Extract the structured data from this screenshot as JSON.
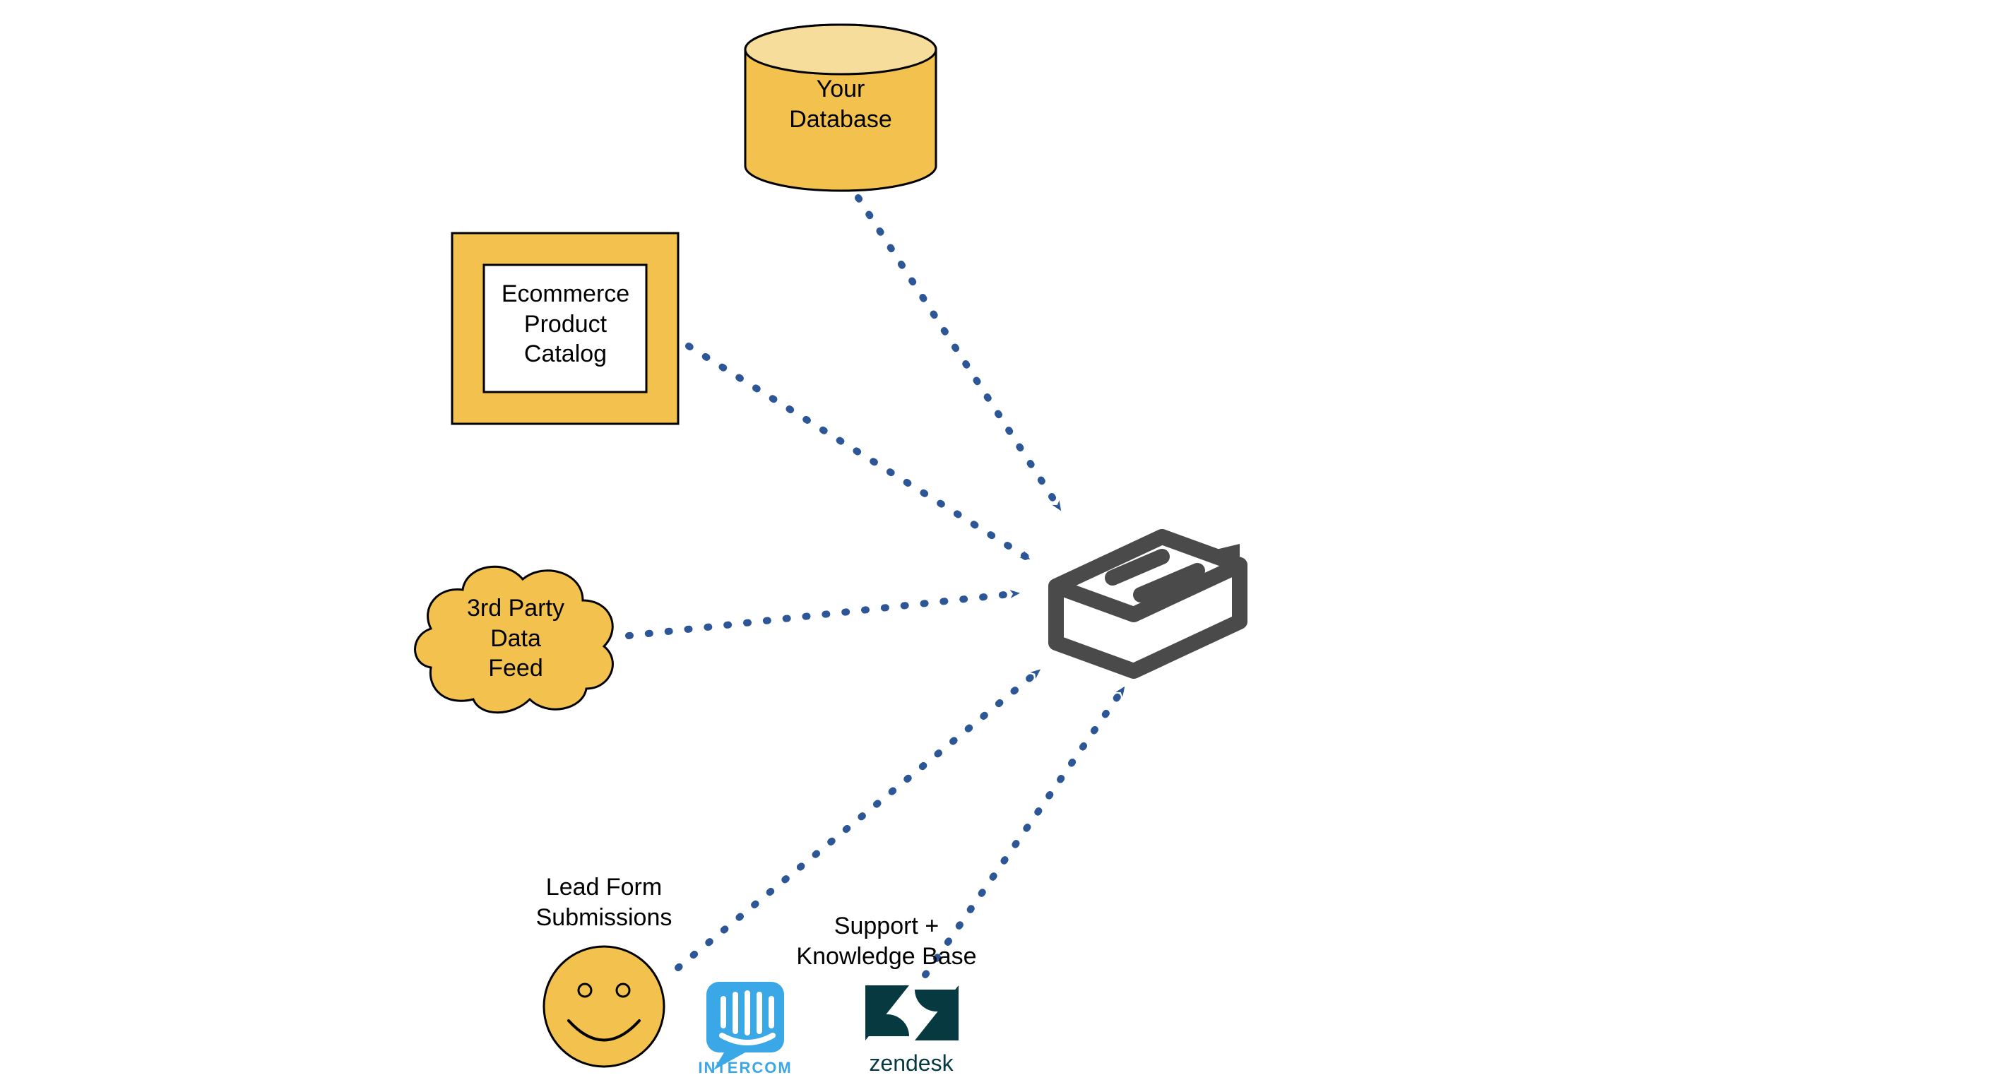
{
  "diagram": {
    "nodes": {
      "database": {
        "label": "Your\nDatabase"
      },
      "catalog": {
        "label": "Ecommerce\nProduct\nCatalog"
      },
      "feed": {
        "label": "3rd Party\nData\nFeed"
      },
      "leads": {
        "label": "Lead Form\nSubmissions"
      },
      "support": {
        "label": "Support +\nKnowledge Base"
      },
      "intercom": {
        "label": "INTERCOM"
      },
      "zendesk": {
        "label": "zendesk"
      }
    },
    "target": {
      "name": "central-platform"
    },
    "colors": {
      "arrow": "#2c5696",
      "node_fill": "#f2c14e",
      "node_fill_light": "#f7dd9b",
      "node_stroke": "#000000",
      "target_stroke": "#4a4a4a",
      "intercom": "#3aa7e6",
      "zendesk": "#063940"
    }
  }
}
